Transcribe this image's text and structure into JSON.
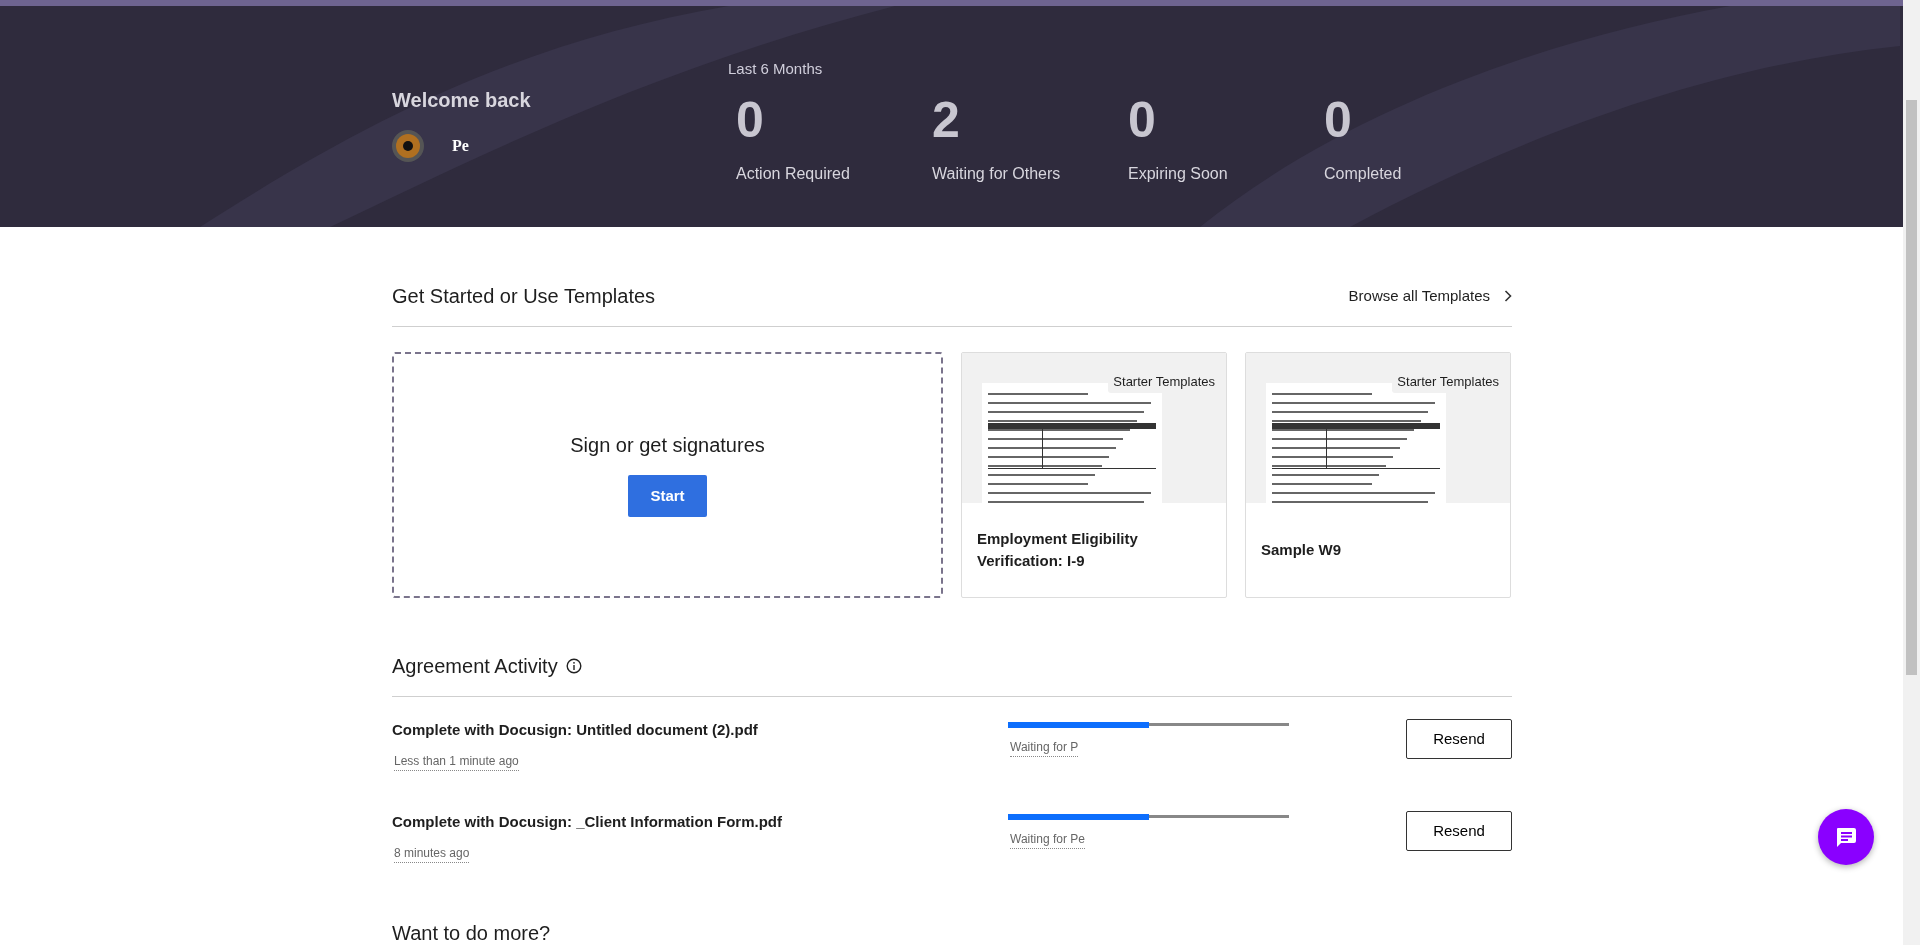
{
  "header": {
    "greeting": "Welcome back",
    "user_name": "Pe",
    "period": "Last 6 Months",
    "stats": [
      {
        "value": "0",
        "label": "Action Required"
      },
      {
        "value": "2",
        "label": "Waiting for Others"
      },
      {
        "value": "0",
        "label": "Expiring Soon"
      },
      {
        "value": "0",
        "label": "Completed"
      }
    ]
  },
  "templates": {
    "title": "Get Started or Use Templates",
    "browse_link": "Browse all Templates",
    "start_card": {
      "title": "Sign or get signatures",
      "button": "Start"
    },
    "items": [
      {
        "badge": "Starter Templates",
        "name": "Employment Eligibility Verification: I-9"
      },
      {
        "badge": "Starter Templates",
        "name": "Sample W9"
      }
    ]
  },
  "activity": {
    "title": "Agreement Activity",
    "rows": [
      {
        "name": "Complete with Docusign: Untitled document (2).pdf",
        "time": "Less than 1 minute ago",
        "level": 0.5,
        "status": "Waiting for P",
        "button": "Resend"
      },
      {
        "name": "Complete with Docusign: _Client Information Form.pdf",
        "time": "8 minutes ago",
        "level": 0.5,
        "status": "Waiting for Pe",
        "button": "Resend"
      }
    ]
  },
  "more": {
    "title": "Want to do more?"
  }
}
